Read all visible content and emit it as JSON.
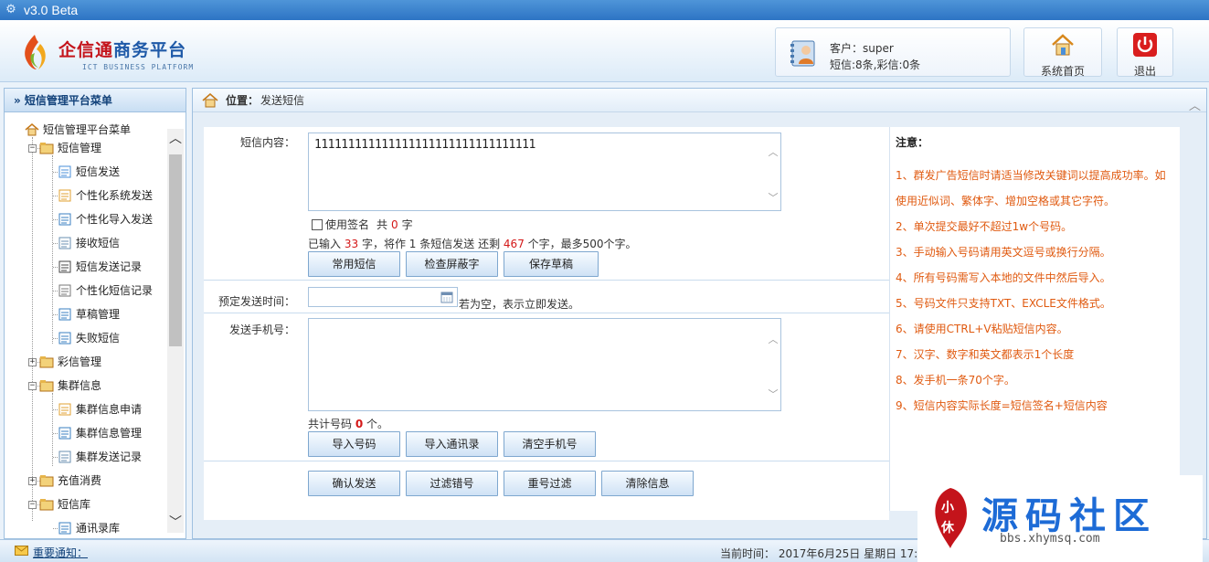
{
  "titlebar": {
    "title": "v3.0  Beta"
  },
  "header": {
    "brand_cn_red": "企信通",
    "brand_cn_blue": "商务平台",
    "brand_en": "ICT BUSINESS PLATFORM",
    "customer": "客户：super",
    "sms_count": "短信:8条,彩信:0条",
    "home_label": "系统首页",
    "exit_label": "退出"
  },
  "sidebar": {
    "header": "» 短信管理平台菜单",
    "root": "短信管理平台菜单",
    "items": [
      {
        "label": "短信管理",
        "level": 1,
        "pm": "−"
      },
      {
        "label": "短信发送",
        "level": 2
      },
      {
        "label": "个性化系统发送",
        "level": 2
      },
      {
        "label": "个性化导入发送",
        "level": 2
      },
      {
        "label": "接收短信",
        "level": 2
      },
      {
        "label": "短信发送记录",
        "level": 2
      },
      {
        "label": "个性化短信记录",
        "level": 2
      },
      {
        "label": "草稿管理",
        "level": 2
      },
      {
        "label": "失败短信",
        "level": 2
      },
      {
        "label": "彩信管理",
        "level": 1,
        "pm": "+"
      },
      {
        "label": "集群信息",
        "level": 1,
        "pm": "−"
      },
      {
        "label": "集群信息申请",
        "level": 2
      },
      {
        "label": "集群信息管理",
        "level": 2
      },
      {
        "label": "集群发送记录",
        "level": 2
      },
      {
        "label": "充值消费",
        "level": 1,
        "pm": "+"
      },
      {
        "label": "短信库",
        "level": 1,
        "pm": "−"
      },
      {
        "label": "通讯录库",
        "level": 2
      }
    ]
  },
  "main": {
    "crumb_prefix": "位置：",
    "crumb_page": "发送短信",
    "content_label": "短信内容：",
    "content_value": "111111111111111111111111111111111",
    "signature_label": "使用签名",
    "sig_total_prefix": "共",
    "sig_count": "0",
    "sig_unit": "字",
    "stats": {
      "p1": "已输入",
      "input_count": "33",
      "p2": "字，将作",
      "sms_count": "1",
      "p3": "条短信发送  还剩",
      "remaining": "467",
      "p4": "个字，最多500个字。"
    },
    "btn_common": "常用短信",
    "btn_check": "检查屏蔽字",
    "btn_draft": "保存草稿",
    "schedule_label": "预定发送时间：",
    "schedule_hint": "若为空，表示立即发送。",
    "phone_label": "发送手机号：",
    "phone_total_prefix": "共计号码",
    "phone_count": "0",
    "phone_total_unit": "个。",
    "btn_import": "导入号码",
    "btn_import_contacts": "导入通讯录",
    "btn_clear_phones": "清空手机号",
    "btn_confirm": "确认发送",
    "btn_filter_wrong": "过滤错号",
    "btn_filter_dup": "重号过滤",
    "btn_clear_info": "清除信息"
  },
  "notes": {
    "title": "注意：",
    "items": [
      "1、群发广告短信时请适当修改关键词以提高成功率。如",
      "使用近似词、繁体字、增加空格或其它字符。",
      "2、单次提交最好不超过1w个号码。",
      "3、手动输入号码请用英文逗号或换行分隔。",
      "4、所有号码需写入本地的文件中然后导入。",
      "5、号码文件只支持TXT、EXCLE文件格式。",
      "6、请使用CTRL+V粘贴短信内容。",
      "7、汉字、数字和英文都表示1个长度",
      "8、发手机一条70个字。",
      "9、短信内容实际长度=短信签名+短信内容"
    ]
  },
  "footer": {
    "notice": "重要通知：",
    "time": "当前时间： 2017年6月25日 星期日 17:09"
  },
  "watermark": {
    "text": "源码社区",
    "url": "bbs.xhymsq.com",
    "seal_text": "小休"
  },
  "colors": {
    "accent": "#2d74c4",
    "note": "#e05a10",
    "highlight": "#d41818"
  }
}
